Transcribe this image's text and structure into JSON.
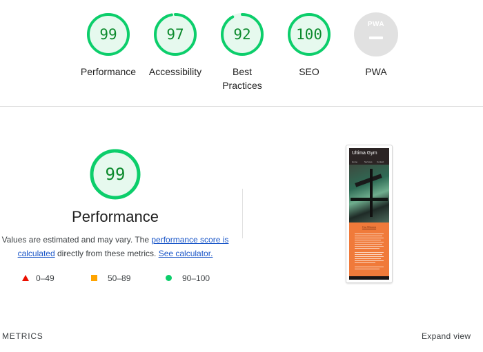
{
  "categories": [
    {
      "label": "Performance",
      "score": "99",
      "fraction": 0.99
    },
    {
      "label": "Accessibility",
      "score": "97",
      "fraction": 0.97
    },
    {
      "label": "Best Practices",
      "score": "92",
      "fraction": 0.92
    },
    {
      "label": "SEO",
      "score": "100",
      "fraction": 1.0
    }
  ],
  "pwa": {
    "label": "PWA",
    "badge_text": "PWA"
  },
  "performance": {
    "score": "99",
    "fraction": 0.99,
    "title": "Performance",
    "desc_prefix": "Values are estimated and may vary. The ",
    "desc_link1": "performance score is calculated",
    "desc_middle": " directly from these metrics. ",
    "desc_link2": "See calculator."
  },
  "legend": {
    "fail": "0–49",
    "average": "50–89",
    "pass": "90–100"
  },
  "thumbnail": {
    "site_title": "Ultima Gym",
    "nav": [
      "Home",
      "Services",
      "Contact"
    ],
    "heading": "Our Mission"
  },
  "footer": {
    "metrics_label": "METRICS",
    "expand_label": "Expand view"
  },
  "colors": {
    "pass_ring": "#0cce6b",
    "pass_fill": "#e6f9ee",
    "pass_text": "#0b8a2c",
    "link": "#1a56c8"
  }
}
